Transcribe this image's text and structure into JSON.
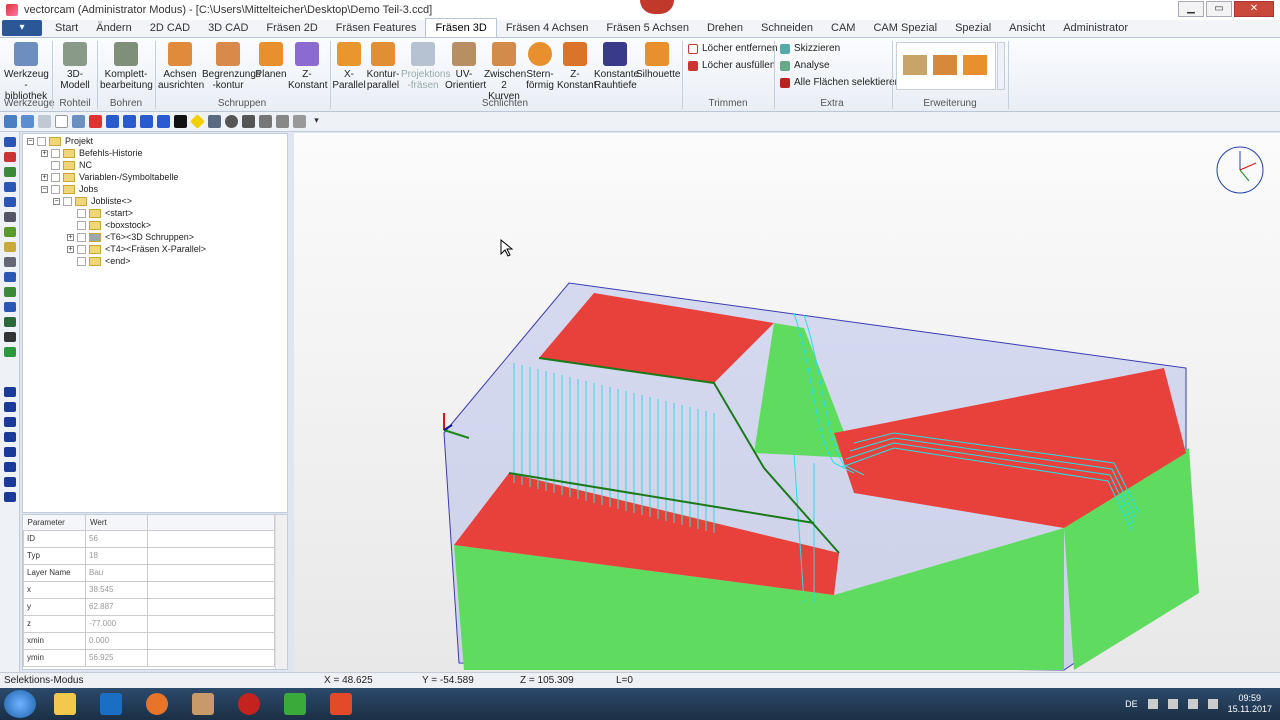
{
  "window": {
    "title": "vectorcam (Administrator Modus) - [C:\\Users\\Mittelteicher\\Desktop\\Demo Teil-3.ccd]",
    "minimize": "▁",
    "maximize": "▭",
    "close": "✕"
  },
  "menu": {
    "file_label": "▾",
    "tabs": [
      "Start",
      "Ändern",
      "2D CAD",
      "3D CAD",
      "Fräsen 2D",
      "Fräsen Features",
      "Fräsen 3D",
      "Fräsen 4 Achsen",
      "Fräsen 5 Achsen",
      "Drehen",
      "Schneiden",
      "CAM",
      "CAM Spezial",
      "Spezial",
      "Ansicht",
      "Administrator"
    ],
    "active_tab": "Fräsen 3D"
  },
  "ribbon": {
    "werkzeug_bibliothek": "Werkzeug\n-bibliothek",
    "modell_3d": "3D-\nModell",
    "komplett": "Komplett-\nbearbeitung",
    "achsen": "Achsen\nausrichten",
    "begrenzung": "Begrenzungs\n-kontur",
    "planen": "Planen",
    "z_konstant": "Z-\nKonstant",
    "x_parallel": "X-\nParallel",
    "kontur_parallel": "Kontur-\nparallel",
    "projektion": "Projektions\n-fräsen",
    "uv": "UV-\nOrientiert",
    "zwischen": "Zwischen\n2 Kurven",
    "stern": "Stern-\nförmig",
    "z_konstant2": "Z-\nKonstant",
    "konst_rauh": "Konstante\nRauhtiefe",
    "silhouette": "Silhouette",
    "loecher_entfernen": "Löcher entfernen",
    "loecher_ausfuellen": "Löcher ausfüllen",
    "skizzieren": "Skizzieren",
    "analyse": "Analyse",
    "alle_flaechen": "Alle Flächen selektieren",
    "groups": {
      "werkzeuge": "Werkzeuge",
      "rohteil": "Rohteil",
      "bohren": "Bohren",
      "schruppen": "Schruppen",
      "schlichten": "Schlichten",
      "trimmen": "Trimmen",
      "extra": "Extra",
      "erweiterung": "Erweiterung"
    }
  },
  "tree": {
    "projekt": "Projekt",
    "befehls": "Befehls-Historie",
    "nc": "NC",
    "variablen": "Variablen-/Symboltabelle",
    "jobs": "Jobs",
    "jobliste": "Jobliste<>",
    "start": "<start>",
    "boxstock": "<boxstock>",
    "t6": "<T6><3D Schruppen>",
    "t4": "<T4><Fräsen X-Parallel>",
    "end": "<end>"
  },
  "params": {
    "header": [
      "Parameter",
      "Wert"
    ],
    "rows": [
      [
        "ID",
        "56"
      ],
      [
        "Typ",
        "18"
      ],
      [
        "Layer Name",
        "Bau"
      ],
      [
        "x",
        "38.545"
      ],
      [
        "y",
        "62.887"
      ],
      [
        "z",
        "-77.000"
      ],
      [
        "xmin",
        "0.000"
      ],
      [
        "ymin",
        "56.925"
      ]
    ]
  },
  "status": {
    "mode": "Selektions-Modus",
    "x": "X = 48.625",
    "y": "Y = -54.589",
    "z": "Z = 105.309",
    "l": "L=0"
  },
  "tray": {
    "lang": "DE",
    "time": "09:59",
    "date": "15.11.2017"
  },
  "colors": {
    "red_face": "#e8413c",
    "green_face": "#5fdc5f",
    "toolpath": "#22e0e8",
    "stock": "#9aa6e8",
    "accent": "#2b5797"
  }
}
